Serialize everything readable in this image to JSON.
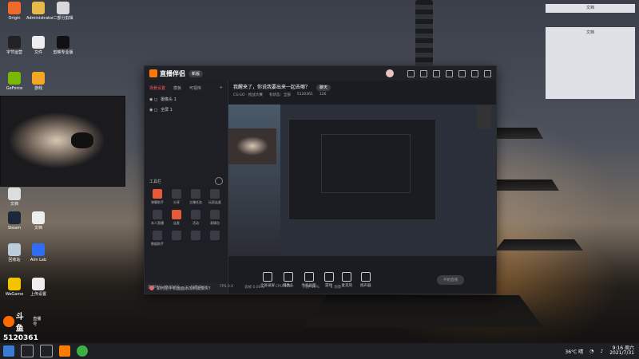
{
  "desktop": {
    "icons": [
      {
        "label": "Origin",
        "color": "#f06a2b"
      },
      {
        "label": "Administrator",
        "color": "#e8b84b"
      },
      {
        "label": "二部分剪辑",
        "color": "#d8d8d8"
      },
      {
        "label": "字节运营",
        "color": "#222"
      },
      {
        "label": "文件",
        "color": "#eee"
      },
      {
        "label": "剪映专业版",
        "color": "#111"
      },
      {
        "label": "GeForce",
        "color": "#76b900"
      },
      {
        "label": "游戏",
        "color": "#f5a623"
      },
      {
        "label": "文档",
        "color": "#ddd"
      },
      {
        "label": "Steam",
        "color": "#1b2838"
      },
      {
        "label": "文档",
        "color": "#eee"
      },
      {
        "label": "回收站",
        "color": "#bcd"
      },
      {
        "label": "Aim Lab",
        "color": "#2e6df6"
      },
      {
        "label": "WeGame",
        "color": "#f4c300"
      },
      {
        "label": "上传设置",
        "color": "#eee"
      }
    ],
    "side_panel_1": "文档",
    "side_panel_2": "文档"
  },
  "watermark": {
    "brand": "斗鱼",
    "room_label": "直播号",
    "room_id": "5120361"
  },
  "app": {
    "name": "直播伴侣",
    "badge": "新版",
    "tabs": [
      "场景设置",
      "模板",
      "可视库"
    ],
    "scenes": [
      "摄像头 1",
      "全屏 1"
    ],
    "tools_title": "工具栏",
    "tools": [
      "弹幕助手",
      "分享",
      "主播任务",
      "玩家连麦",
      "本人直播",
      "连麦",
      "活动",
      "表情包",
      "数据助手",
      "",
      "",
      ""
    ],
    "tip": "如何把手机画面添加到摄像头？",
    "room_title": "我醒来了，你说我要出来一起去哪？",
    "room_tag": "聊天",
    "room_sub": [
      "CS:GO · 枪战大赛",
      "有状态：全部",
      "5120361",
      "126"
    ],
    "bottom_buttons": [
      "全屏录屏",
      "摄像头",
      "手机画面",
      "游戏",
      "麦克风",
      "扬声器"
    ],
    "go_live": "开始直播",
    "status_items": [
      "直播时长 00:00:00",
      "码率 0kb/s",
      "FPS 0.0",
      "丢帧 0.00%",
      "CPU 46%",
      "内存 39%",
      "1 场景"
    ]
  },
  "taskbar": {
    "weather": "36°C 晴",
    "time": "9:16 周六",
    "date": "2021/7/31"
  }
}
